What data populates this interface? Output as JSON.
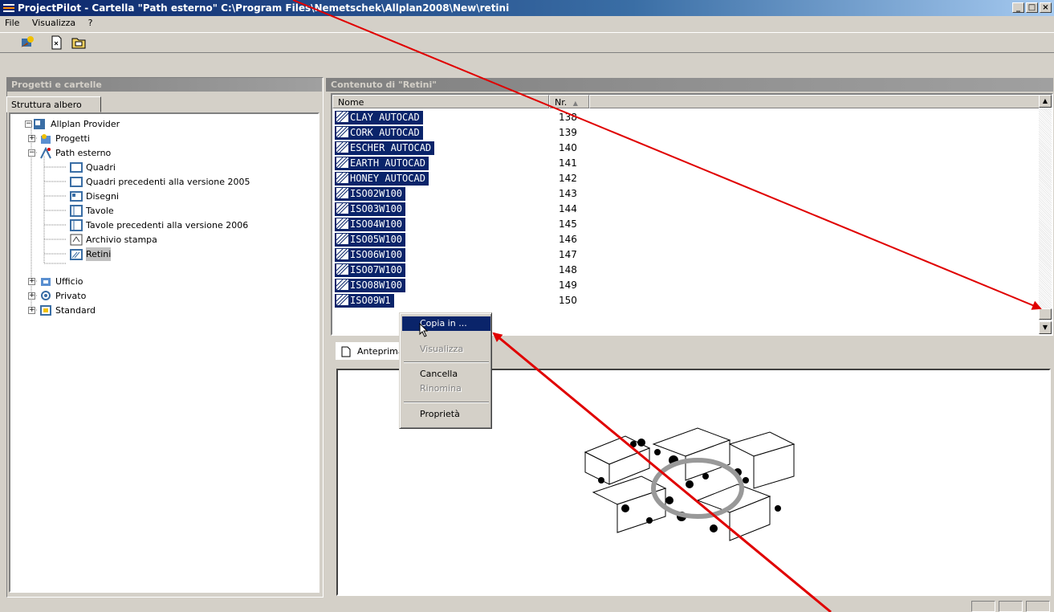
{
  "window": {
    "title": "ProjectPilot - Cartella \"Path esterno\" C:\\Program Files\\Nemetschek\\Allplan2008\\New\\retini",
    "controls": [
      "minimize",
      "maximize",
      "close"
    ]
  },
  "menu": [
    "File",
    "Visualizza",
    "?"
  ],
  "toolbar": {
    "buttons": [
      {
        "icon": "settings-wizard-icon"
      },
      {
        "icon": "document-icon"
      },
      {
        "icon": "folder-icon"
      }
    ]
  },
  "left_panel": {
    "header": "Progetti e cartelle",
    "tab": "Struttura albero",
    "tree": [
      {
        "label": "Allplan Provider",
        "level": 0,
        "expander": "−"
      },
      {
        "label": "Progetti",
        "level": 1,
        "expander": "+"
      },
      {
        "label": "Path esterno",
        "level": 1,
        "expander": "−"
      },
      {
        "label": "Quadri",
        "level": 2
      },
      {
        "label": "Quadri precedenti alla versione 2005",
        "level": 2
      },
      {
        "label": "Disegni",
        "level": 2
      },
      {
        "label": "Tavole",
        "level": 2
      },
      {
        "label": "Tavole precedenti alla versione 2006",
        "level": 2
      },
      {
        "label": "Archivio stampa",
        "level": 2
      },
      {
        "label": "Retini",
        "level": 2,
        "selected": true
      },
      {
        "label": "Ufficio",
        "level": 1,
        "expander": "+"
      },
      {
        "label": "Privato",
        "level": 1,
        "expander": "+"
      },
      {
        "label": "Standard",
        "level": 1,
        "expander": "+"
      }
    ]
  },
  "right_panel": {
    "header": "Contenuto di \"Retini\"",
    "columns": {
      "name": "Nome",
      "nr": "Nr."
    },
    "rows": [
      {
        "name": "CLAY AUTOCAD",
        "nr": "138"
      },
      {
        "name": "CORK AUTOCAD",
        "nr": "139"
      },
      {
        "name": "ESCHER AUTOCAD",
        "nr": "140"
      },
      {
        "name": "EARTH AUTOCAD",
        "nr": "141"
      },
      {
        "name": "HONEY AUTOCAD",
        "nr": "142"
      },
      {
        "name": "ISO02W100",
        "nr": "143"
      },
      {
        "name": "ISO03W100",
        "nr": "144"
      },
      {
        "name": "ISO04W100",
        "nr": "145"
      },
      {
        "name": "ISO05W100",
        "nr": "146"
      },
      {
        "name": "ISO06W100",
        "nr": "147"
      },
      {
        "name": "ISO07W100",
        "nr": "148"
      },
      {
        "name": "ISO08W100",
        "nr": "149"
      },
      {
        "name": "ISO09W1",
        "nr": "150"
      }
    ],
    "preview_tab": "Anteprima"
  },
  "context_menu": [
    {
      "label": "Copia in ...",
      "state": "highlighted"
    },
    {
      "label": "Visualizza",
      "state": "disabled"
    },
    {
      "label": "Cancella",
      "state": "enabled"
    },
    {
      "label": "Rinomina",
      "state": "disabled"
    },
    {
      "label": "Proprietà",
      "state": "enabled"
    }
  ],
  "colors": {
    "titlebar_start": "#0a246a",
    "selection": "#0a246a",
    "annotation_arrow": "#e00000",
    "face": "#d4d0c8"
  }
}
